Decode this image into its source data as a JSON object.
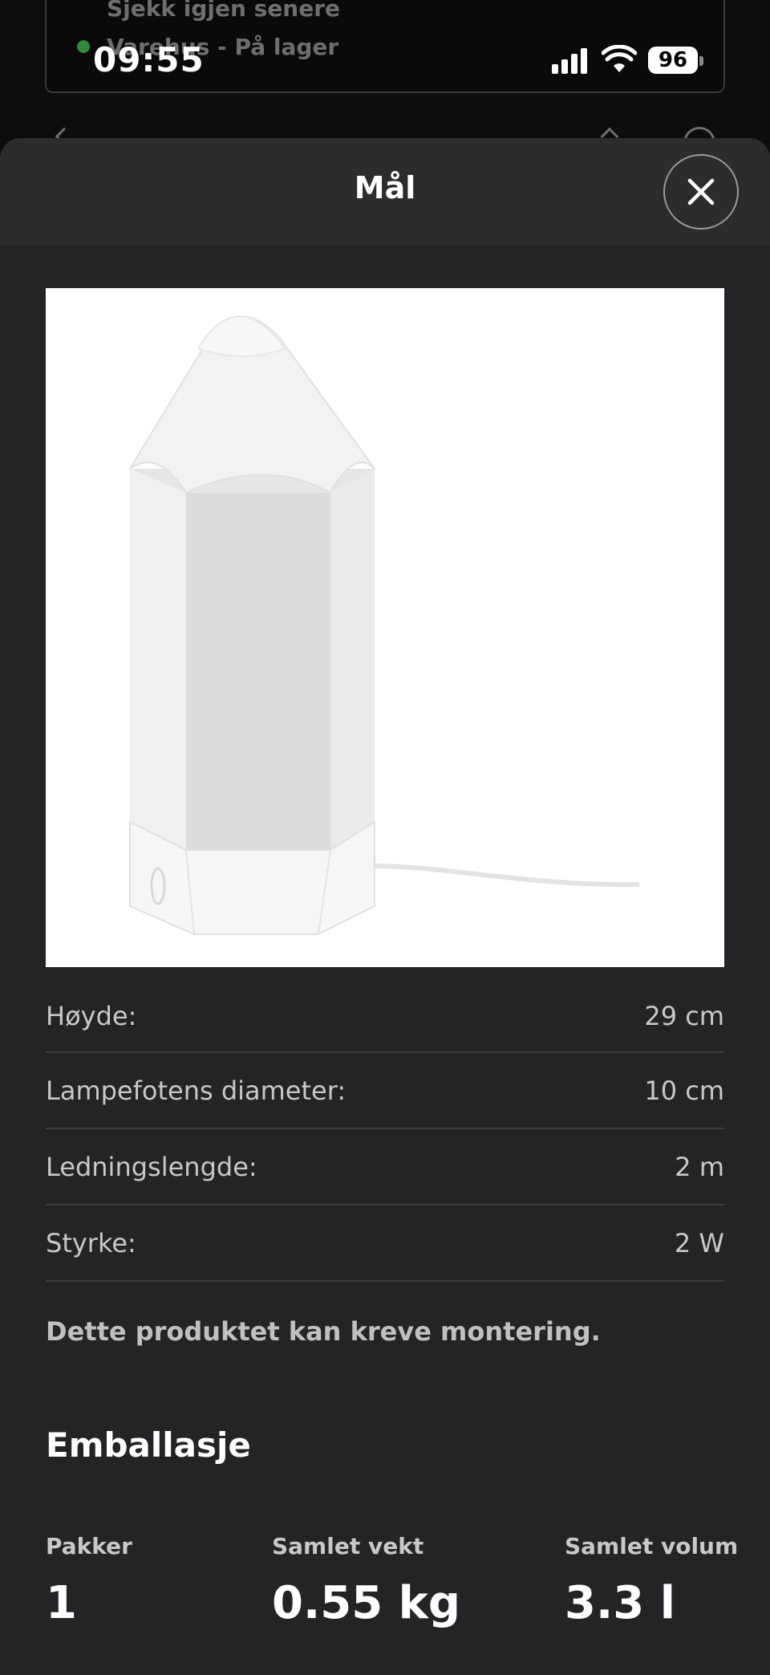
{
  "status_bar": {
    "time": "09:55",
    "battery": "96"
  },
  "background_page": {
    "stock_line1": "Sjekk igjen senere",
    "stock_line2": "Varehus - På lager"
  },
  "sheet": {
    "title": "Mål",
    "close_icon": "close-icon"
  },
  "product_image": {
    "alt": "lamp-product-image"
  },
  "specs": [
    {
      "label": "Høyde:",
      "value": "29 cm"
    },
    {
      "label": "Lampefotens diameter:",
      "value": "10 cm"
    },
    {
      "label": "Ledningslengde:",
      "value": "2 m"
    },
    {
      "label": "Styrke:",
      "value": "2 W"
    }
  ],
  "assembly_note": "Dette produktet kan kreve montering.",
  "packaging": {
    "title": "Emballasje",
    "items": [
      {
        "label": "Pakker",
        "value": "1"
      },
      {
        "label": "Samlet vekt",
        "value": "0.55 kg"
      },
      {
        "label": "Samlet volum",
        "value": "3.3 l"
      }
    ]
  },
  "colors": {
    "sheet_bg": "#242426",
    "header_bg": "#2c2c2e",
    "divider": "#3e3e40",
    "stock_green": "#2f8a3a"
  }
}
